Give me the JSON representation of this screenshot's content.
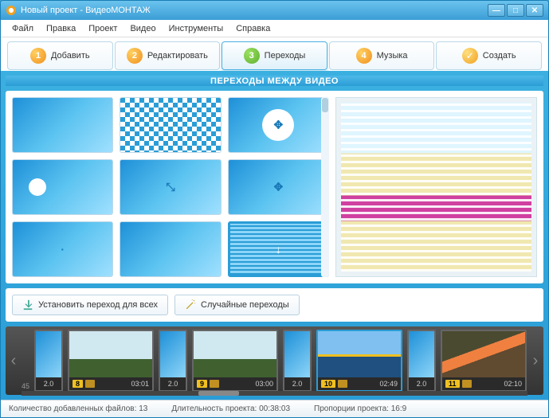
{
  "window": {
    "title": "Новый проект - ВидеоМОНТАЖ"
  },
  "menu": {
    "file": "Файл",
    "edit": "Правка",
    "project": "Проект",
    "video": "Видео",
    "tools": "Инструменты",
    "help": "Справка"
  },
  "tabs": {
    "t1": {
      "num": "1",
      "label": "Добавить"
    },
    "t2": {
      "num": "2",
      "label": "Редактировать"
    },
    "t3": {
      "num": "3",
      "label": "Переходы"
    },
    "t4": {
      "num": "4",
      "label": "Музыка"
    },
    "t5": {
      "label": "Создать"
    }
  },
  "section": {
    "header": "ПЕРЕХОДЫ МЕЖДУ ВИДЕО"
  },
  "buttons": {
    "apply_all": "Установить переход для всех",
    "random": "Случайные переходы"
  },
  "timeline": {
    "marker_start": "45",
    "trans_dur": "2.0",
    "clips": [
      {
        "num": "8",
        "time": "03:01"
      },
      {
        "num": "9",
        "time": "03:00"
      },
      {
        "num": "10",
        "time": "02:49"
      },
      {
        "num": "11",
        "time": "02:10"
      }
    ]
  },
  "status": {
    "files_label": "Количество добавленных файлов:",
    "files_count": "13",
    "duration_label": "Длительность проекта:",
    "duration_value": "00:38:03",
    "ratio_label": "Пропорции проекта:",
    "ratio_value": "16:9"
  }
}
